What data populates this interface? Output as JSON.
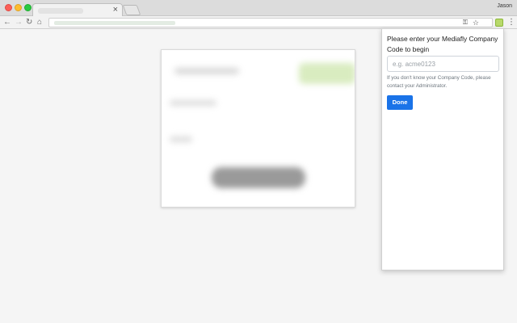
{
  "browser": {
    "profile_name": "Jason",
    "tab": {
      "close_glyph": "×"
    }
  },
  "toolbar": {
    "back_glyph": "←",
    "forward_glyph": "→",
    "reload_glyph": "↻",
    "home_glyph": "⌂",
    "key_glyph": "⚿",
    "star_glyph": "☆",
    "menu_glyph": "⋮"
  },
  "popup": {
    "prompt": "Please enter your Mediafly Company Code to begin",
    "input_value": "",
    "input_placeholder": "e.g. acme0123",
    "help_text": "If you don't know your Company Code, please contact your Administrator.",
    "done_label": "Done",
    "accent_color": "#1a73e8"
  }
}
